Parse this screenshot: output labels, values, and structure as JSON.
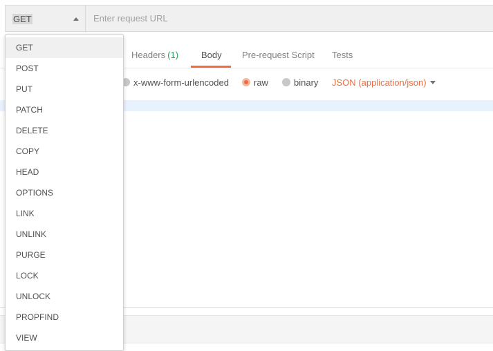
{
  "request": {
    "method": "GET",
    "url_placeholder": "Enter request URL",
    "url_value": ""
  },
  "tabs": {
    "headers_label": "Headers",
    "headers_count": "(1)",
    "body_label": "Body",
    "prerequest_label": "Pre-request Script",
    "tests_label": "Tests"
  },
  "body_options": {
    "urlencoded_label": "x-www-form-urlencoded",
    "raw_label": "raw",
    "binary_label": "binary",
    "content_type": "JSON (application/json)"
  },
  "method_menu": {
    "selected": "GET",
    "items": [
      "GET",
      "POST",
      "PUT",
      "PATCH",
      "DELETE",
      "COPY",
      "HEAD",
      "OPTIONS",
      "LINK",
      "UNLINK",
      "PURGE",
      "LOCK",
      "UNLOCK",
      "PROPFIND",
      "VIEW"
    ]
  },
  "colors": {
    "accent": "#f26b3a",
    "count_green": "#26a65b",
    "editor_highlight": "#e8f2fe"
  },
  "icons": {
    "method_caret": "caret-up-icon",
    "content_type_caret": "caret-down-icon"
  }
}
